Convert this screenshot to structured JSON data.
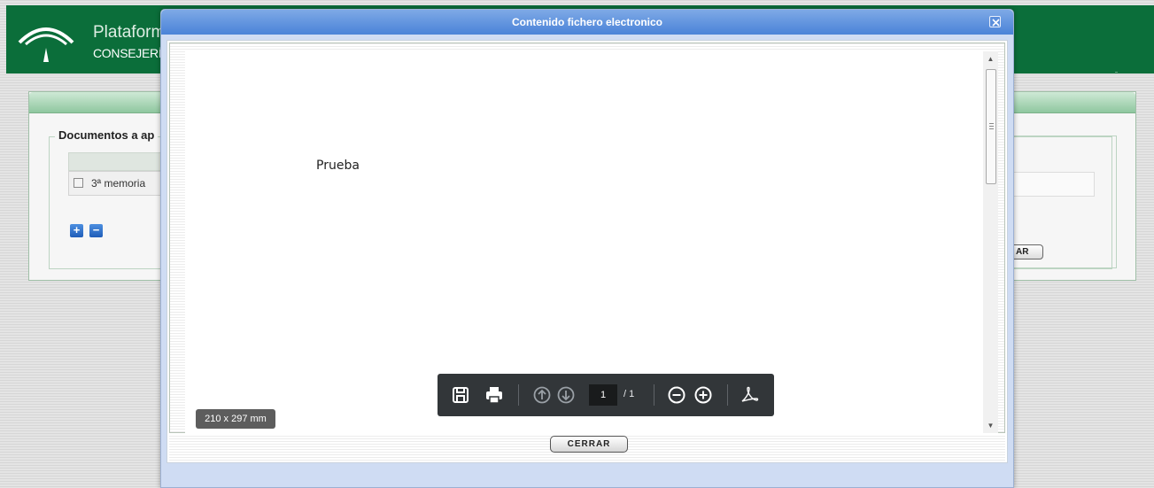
{
  "app": {
    "title_line1": "Plataform",
    "title_line2": "CONSEJERÍA",
    "brand_color": "#0b6e3a"
  },
  "background_panel": {
    "fieldset_legend": "Documentos a ap",
    "rows": [
      {
        "label": "3ª memoria",
        "checked": false
      }
    ],
    "add_icon": "plus-icon",
    "remove_icon": "minus-icon",
    "right_button_label": "AR"
  },
  "modal": {
    "title": "Contenido fichero electronico",
    "close_icon": "close-icon",
    "title_bar_color": "#5b8fdd",
    "document": {
      "text": "Prueba",
      "page_size_label": "210 x 297 mm"
    },
    "toolbar": {
      "save_icon": "save-icon",
      "print_icon": "print-icon",
      "prev_page_icon": "arrow-up-circle-icon",
      "next_page_icon": "arrow-down-circle-icon",
      "current_page": "1",
      "total_pages": "/ 1",
      "zoom_out_icon": "zoom-out-icon",
      "zoom_in_icon": "zoom-in-icon",
      "acrobat_icon": "acrobat-icon"
    },
    "close_button_label": "CERRAR"
  }
}
